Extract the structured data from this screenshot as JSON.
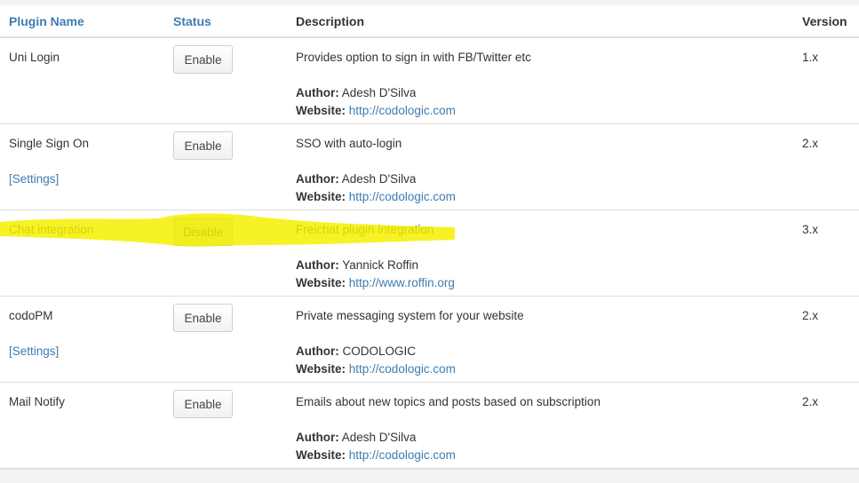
{
  "table": {
    "headers": {
      "name": "Plugin Name",
      "status": "Status",
      "description": "Description",
      "version": "Version"
    },
    "labels": {
      "author": "Author:",
      "website": "Website:"
    },
    "highlight_color": "#f5f000",
    "rows": [
      {
        "name": "Uni Login",
        "settings": "",
        "button": "Enable",
        "description": "Provides option to sign in with FB/Twitter etc",
        "author": "Adesh D'Silva",
        "website": "http://codologic.com",
        "version": "1.x"
      },
      {
        "name": "Single Sign On",
        "settings": "[Settings]",
        "button": "Enable",
        "description": "SSO with auto-login",
        "author": "Adesh D'Silva",
        "website": "http://codologic.com",
        "version": "2.x"
      },
      {
        "name": "Chat integration",
        "settings": "",
        "button": "Disable",
        "description": "Freichat plugin integration",
        "author": "Yannick Roffin",
        "website": "http://www.roffin.org",
        "version": "3.x"
      },
      {
        "name": "codoPM",
        "settings": "[Settings]",
        "button": "Enable",
        "description": "Private messaging system for your website",
        "author": "CODOLOGIC",
        "website": "http://codologic.com",
        "version": "2.x"
      },
      {
        "name": "Mail Notify",
        "settings": "",
        "button": "Enable",
        "description": "Emails about new topics and posts based on subscription",
        "author": "Adesh D'Silva",
        "website": "http://codologic.com",
        "version": "2.x"
      }
    ]
  }
}
